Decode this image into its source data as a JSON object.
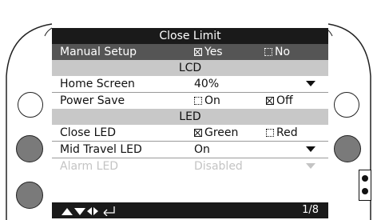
{
  "screen": {
    "title": "Close Limit",
    "rows": {
      "manual_setup": {
        "label": "Manual Setup",
        "opt1": "Yes",
        "opt1_checked": true,
        "opt2": "No",
        "opt2_checked": false
      },
      "lcd_header": "LCD",
      "home_screen": {
        "label": "Home Screen",
        "value": "40%"
      },
      "power_save": {
        "label": "Power Save",
        "opt1": "On",
        "opt1_checked": false,
        "opt2": "Off",
        "opt2_checked": true
      },
      "led_header": "LED",
      "close_led": {
        "label": "Close LED",
        "opt1": "Green",
        "opt1_checked": true,
        "opt2": "Red",
        "opt2_checked": false
      },
      "mid_travel_led": {
        "label": "Mid Travel LED",
        "value": "On"
      },
      "alarm_led": {
        "label": "Alarm LED",
        "value": "Disabled",
        "enabled": false
      }
    },
    "footer": {
      "nav_icons": [
        "up-arrow-icon",
        "down-arrow-icon",
        "left-arrow-icon",
        "right-arrow-icon",
        "enter-icon"
      ],
      "page": "1/8"
    }
  },
  "colors": {
    "title_bar": "#1a1a1a",
    "highlight_row": "#555555",
    "section_header": "#c8c8c8",
    "disabled_text": "#c4c4c4",
    "grey_button": "#7a7a7a"
  }
}
